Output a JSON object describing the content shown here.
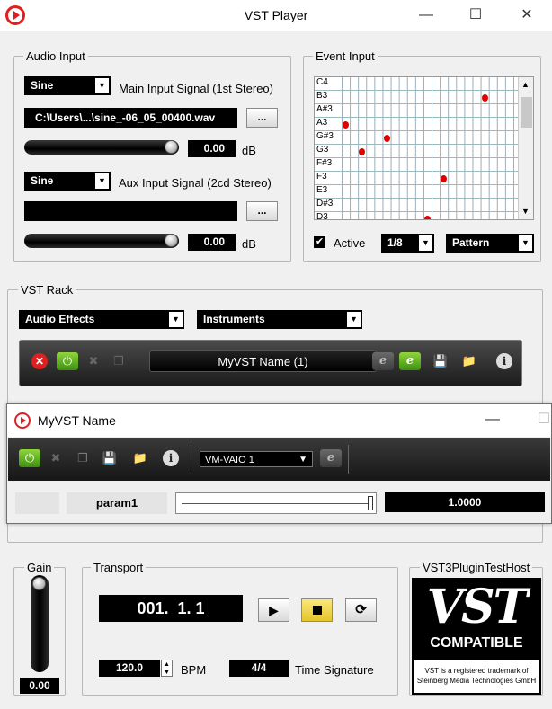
{
  "window": {
    "title": "VST Player"
  },
  "audio_input": {
    "label": "Audio Input",
    "main_signal_select": "Sine",
    "main_signal_label": "Main Input Signal (1st Stereo)",
    "main_file_path": "C:\\Users\\...\\sine_-06_05_00400.wav",
    "browse_label": "...",
    "main_gain_value": "0.00",
    "main_gain_unit": "dB",
    "aux_signal_select": "Sine",
    "aux_signal_label": "Aux Input Signal (2cd Stereo)",
    "aux_file_path": "",
    "aux_gain_value": "0.00",
    "aux_gain_unit": "dB"
  },
  "event_input": {
    "label": "Event Input",
    "note_labels": [
      "C4",
      "B3",
      "A#3",
      "A3",
      "G#3",
      "G3",
      "F#3",
      "F3",
      "E3",
      "D#3",
      "D3"
    ],
    "notes": [
      {
        "note": "B3",
        "step": 17
      },
      {
        "note": "A3",
        "step": 0
      },
      {
        "note": "G#3",
        "step": 5
      },
      {
        "note": "G3",
        "step": 2
      },
      {
        "note": "F3",
        "step": 12
      },
      {
        "note": "D3",
        "step": 10
      }
    ],
    "active_label": "Active",
    "active_checked": true,
    "resolution_select": "1/8",
    "mode_select": "Pattern"
  },
  "vst_rack": {
    "label": "VST Rack",
    "effects_select": "Audio Effects",
    "instruments_select": "Instruments",
    "plugin_name": "MyVST Name (1)",
    "edit_glyph": "e"
  },
  "plugin_window": {
    "title": "MyVST Name",
    "preset_select": "VM-VAIO 1",
    "edit_glyph": "e",
    "param_name": "param1",
    "param_value": "1.0000",
    "param_level": 1.0
  },
  "gain": {
    "label": "Gain",
    "value": "0.00"
  },
  "transport": {
    "label": "Transport",
    "position": "001.  1. 1",
    "bpm_value": "120.0",
    "bpm_label": "BPM",
    "time_signature_value": "4/4",
    "time_signature_label": "Time Signature"
  },
  "logo_panel": {
    "label": "VST3PluginTestHost",
    "logo_text": "VST",
    "compatible_text": "COMPATIBLE",
    "trademark_line1": "VST is a registered trademark of",
    "trademark_line2": "Steinberg Media Technologies GmbH"
  },
  "colors": {
    "accent_red": "#e02020",
    "green_active": "#5cb320",
    "note_red": "#e00000",
    "transport_stop": "#f1d83a"
  }
}
